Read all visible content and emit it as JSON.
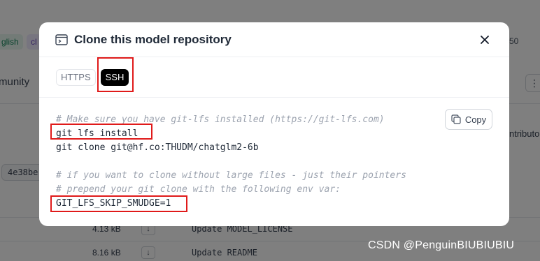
{
  "background": {
    "chip_a": "glish",
    "chip_b": "cl",
    "stray_number": "50",
    "community": "munity",
    "kebab": "⋮",
    "contributors": "ntributor",
    "commit": "4e38be",
    "files": [
      {
        "size": "4.13 kB",
        "message": "Update MODEL_LICENSE"
      },
      {
        "size": "8.16 kB",
        "message": "Update README"
      }
    ]
  },
  "modal": {
    "title": "Clone this model repository",
    "tabs": [
      {
        "label": "HTTPS",
        "active": false
      },
      {
        "label": "SSH",
        "active": true
      }
    ],
    "copy_label": "Copy",
    "code_lines": [
      {
        "text": "# Make sure you have git-lfs installed (https://git-lfs.com)",
        "kind": "comment"
      },
      {
        "text": "git lfs install",
        "kind": "command"
      },
      {
        "text": "git clone git@hf.co:THUDM/chatglm2-6b",
        "kind": "command"
      },
      {
        "text": "",
        "kind": "blank"
      },
      {
        "text": "# if you want to clone without large files - just their pointers",
        "kind": "comment"
      },
      {
        "text": "# prepend your git clone with the following env var:",
        "kind": "comment"
      },
      {
        "text": "GIT_LFS_SKIP_SMUDGE=1",
        "kind": "command"
      }
    ]
  },
  "icons": {
    "repo": "terminal-window-icon",
    "close": "close-icon",
    "copy": "copy-icon",
    "download": "download-icon"
  },
  "watermark": "CSDN @PenguinBIUBIUBIU",
  "colors": {
    "annotation": "#e01a1a",
    "active_tab": "#000000",
    "comment": "#9ca3af",
    "overlay": "rgba(0,0,0,0.5)"
  }
}
